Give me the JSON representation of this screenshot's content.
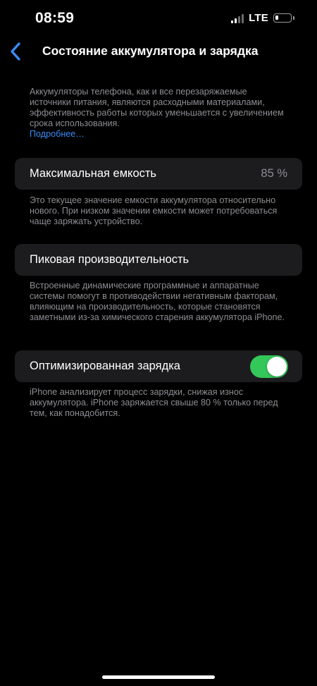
{
  "status_bar": {
    "time": "08:59",
    "network": "LTE",
    "battery_level": 0.2,
    "signal_bars": 2
  },
  "nav": {
    "back_icon": "chevron-left-icon",
    "title": "Состояние аккумулятора и зарядка"
  },
  "intro": {
    "text": "Аккумуляторы телефона, как и все перезаряжаемые источники питания, являются расходными материалами, эффективность работы которых уменьшается с увеличением срока использования.",
    "link": "Подробнее…"
  },
  "max_capacity": {
    "label": "Максимальная емкость",
    "value": "85 %",
    "footnote": "Это текущее значение емкости аккумулятора относительно нового. При низком значении емкости может потребоваться чаще заряжать устройство."
  },
  "peak_performance": {
    "label": "Пиковая производительность",
    "footnote": "Встроенные динамические программные и аппаратные системы помогут в противодействии негативным факторам, влияющим на производительность, которые становятся заметными из-за химического старения аккумулятора iPhone."
  },
  "optimized_charging": {
    "label": "Оптимизированная зарядка",
    "enabled": true,
    "footnote": "iPhone анализирует процесс зарядки, снижая износ аккумулятора. iPhone заряжается свыше 80 % только перед тем, как понадобится."
  },
  "colors": {
    "background": "#000000",
    "cell": "#1c1c1e",
    "secondary_text": "#8d8d93",
    "link": "#3a8cf7",
    "toggle_on": "#34c759"
  }
}
